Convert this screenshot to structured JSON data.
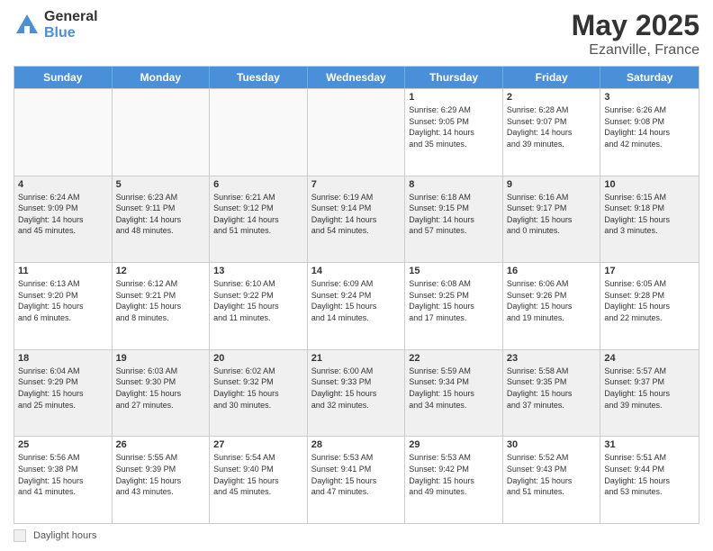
{
  "logo": {
    "general": "General",
    "blue": "Blue"
  },
  "title": {
    "month_year": "May 2025",
    "location": "Ezanville, France"
  },
  "header_days": [
    "Sunday",
    "Monday",
    "Tuesday",
    "Wednesday",
    "Thursday",
    "Friday",
    "Saturday"
  ],
  "footer": {
    "label": "Daylight hours"
  },
  "weeks": [
    [
      {
        "day": "",
        "info": ""
      },
      {
        "day": "",
        "info": ""
      },
      {
        "day": "",
        "info": ""
      },
      {
        "day": "",
        "info": ""
      },
      {
        "day": "1",
        "info": "Sunrise: 6:29 AM\nSunset: 9:05 PM\nDaylight: 14 hours\nand 35 minutes."
      },
      {
        "day": "2",
        "info": "Sunrise: 6:28 AM\nSunset: 9:07 PM\nDaylight: 14 hours\nand 39 minutes."
      },
      {
        "day": "3",
        "info": "Sunrise: 6:26 AM\nSunset: 9:08 PM\nDaylight: 14 hours\nand 42 minutes."
      }
    ],
    [
      {
        "day": "4",
        "info": "Sunrise: 6:24 AM\nSunset: 9:09 PM\nDaylight: 14 hours\nand 45 minutes."
      },
      {
        "day": "5",
        "info": "Sunrise: 6:23 AM\nSunset: 9:11 PM\nDaylight: 14 hours\nand 48 minutes."
      },
      {
        "day": "6",
        "info": "Sunrise: 6:21 AM\nSunset: 9:12 PM\nDaylight: 14 hours\nand 51 minutes."
      },
      {
        "day": "7",
        "info": "Sunrise: 6:19 AM\nSunset: 9:14 PM\nDaylight: 14 hours\nand 54 minutes."
      },
      {
        "day": "8",
        "info": "Sunrise: 6:18 AM\nSunset: 9:15 PM\nDaylight: 14 hours\nand 57 minutes."
      },
      {
        "day": "9",
        "info": "Sunrise: 6:16 AM\nSunset: 9:17 PM\nDaylight: 15 hours\nand 0 minutes."
      },
      {
        "day": "10",
        "info": "Sunrise: 6:15 AM\nSunset: 9:18 PM\nDaylight: 15 hours\nand 3 minutes."
      }
    ],
    [
      {
        "day": "11",
        "info": "Sunrise: 6:13 AM\nSunset: 9:20 PM\nDaylight: 15 hours\nand 6 minutes."
      },
      {
        "day": "12",
        "info": "Sunrise: 6:12 AM\nSunset: 9:21 PM\nDaylight: 15 hours\nand 8 minutes."
      },
      {
        "day": "13",
        "info": "Sunrise: 6:10 AM\nSunset: 9:22 PM\nDaylight: 15 hours\nand 11 minutes."
      },
      {
        "day": "14",
        "info": "Sunrise: 6:09 AM\nSunset: 9:24 PM\nDaylight: 15 hours\nand 14 minutes."
      },
      {
        "day": "15",
        "info": "Sunrise: 6:08 AM\nSunset: 9:25 PM\nDaylight: 15 hours\nand 17 minutes."
      },
      {
        "day": "16",
        "info": "Sunrise: 6:06 AM\nSunset: 9:26 PM\nDaylight: 15 hours\nand 19 minutes."
      },
      {
        "day": "17",
        "info": "Sunrise: 6:05 AM\nSunset: 9:28 PM\nDaylight: 15 hours\nand 22 minutes."
      }
    ],
    [
      {
        "day": "18",
        "info": "Sunrise: 6:04 AM\nSunset: 9:29 PM\nDaylight: 15 hours\nand 25 minutes."
      },
      {
        "day": "19",
        "info": "Sunrise: 6:03 AM\nSunset: 9:30 PM\nDaylight: 15 hours\nand 27 minutes."
      },
      {
        "day": "20",
        "info": "Sunrise: 6:02 AM\nSunset: 9:32 PM\nDaylight: 15 hours\nand 30 minutes."
      },
      {
        "day": "21",
        "info": "Sunrise: 6:00 AM\nSunset: 9:33 PM\nDaylight: 15 hours\nand 32 minutes."
      },
      {
        "day": "22",
        "info": "Sunrise: 5:59 AM\nSunset: 9:34 PM\nDaylight: 15 hours\nand 34 minutes."
      },
      {
        "day": "23",
        "info": "Sunrise: 5:58 AM\nSunset: 9:35 PM\nDaylight: 15 hours\nand 37 minutes."
      },
      {
        "day": "24",
        "info": "Sunrise: 5:57 AM\nSunset: 9:37 PM\nDaylight: 15 hours\nand 39 minutes."
      }
    ],
    [
      {
        "day": "25",
        "info": "Sunrise: 5:56 AM\nSunset: 9:38 PM\nDaylight: 15 hours\nand 41 minutes."
      },
      {
        "day": "26",
        "info": "Sunrise: 5:55 AM\nSunset: 9:39 PM\nDaylight: 15 hours\nand 43 minutes."
      },
      {
        "day": "27",
        "info": "Sunrise: 5:54 AM\nSunset: 9:40 PM\nDaylight: 15 hours\nand 45 minutes."
      },
      {
        "day": "28",
        "info": "Sunrise: 5:53 AM\nSunset: 9:41 PM\nDaylight: 15 hours\nand 47 minutes."
      },
      {
        "day": "29",
        "info": "Sunrise: 5:53 AM\nSunset: 9:42 PM\nDaylight: 15 hours\nand 49 minutes."
      },
      {
        "day": "30",
        "info": "Sunrise: 5:52 AM\nSunset: 9:43 PM\nDaylight: 15 hours\nand 51 minutes."
      },
      {
        "day": "31",
        "info": "Sunrise: 5:51 AM\nSunset: 9:44 PM\nDaylight: 15 hours\nand 53 minutes."
      }
    ]
  ]
}
